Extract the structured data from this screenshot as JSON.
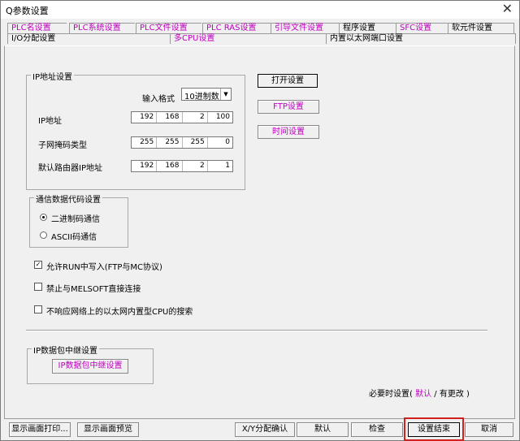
{
  "window": {
    "title": "Q参数设置",
    "close_glyph": "✕"
  },
  "tabs_row1": [
    "PLC名设置",
    "PLC系统设置",
    "PLC文件设置",
    "PLC RAS设置",
    "引导文件设置",
    "程序设置",
    "SFC设置",
    "软元件设置"
  ],
  "tabs_row2": [
    "I/O分配设置",
    "多CPU设置",
    "内置以太网端口设置"
  ],
  "ip_group": {
    "title": "IP地址设置",
    "input_format_label": "输入格式",
    "input_format_value": "10进制数",
    "ip_label": "IP地址",
    "ip": [
      "192",
      "168",
      "2",
      "100"
    ],
    "subnet_label": "子网掩码类型",
    "subnet": [
      "255",
      "255",
      "255",
      "0"
    ],
    "gateway_label": "默认路由器IP地址",
    "gateway": [
      "192",
      "168",
      "2",
      "1"
    ]
  },
  "side_buttons": {
    "open": "打开设置",
    "ftp": "FTP设置",
    "time": "时间设置"
  },
  "code_group": {
    "title": "通信数据代码设置",
    "binary": "二进制码通信",
    "ascii": "ASCII码通信"
  },
  "checks": {
    "allow_run_write": "允许RUN中写入(FTP与MC协议)",
    "forbid_melsoft": "禁止与MELSOFT直接连接",
    "no_search": "不响应网络上的以太网内置型CPU的搜索"
  },
  "relay_group": {
    "title": "IP数据包中继设置",
    "button": "IP数据包中继设置"
  },
  "when_needed": {
    "prefix": "必要时设置(",
    "default": "默认",
    "slash": "/",
    "changed": "有更改",
    "suffix": ")"
  },
  "bottom": {
    "print": "显示画面打印...",
    "preview": "显示画面预览",
    "xy": "X/Y分配确认",
    "default": "默认",
    "check": "检查",
    "finish": "设置结束",
    "cancel": "取消"
  }
}
